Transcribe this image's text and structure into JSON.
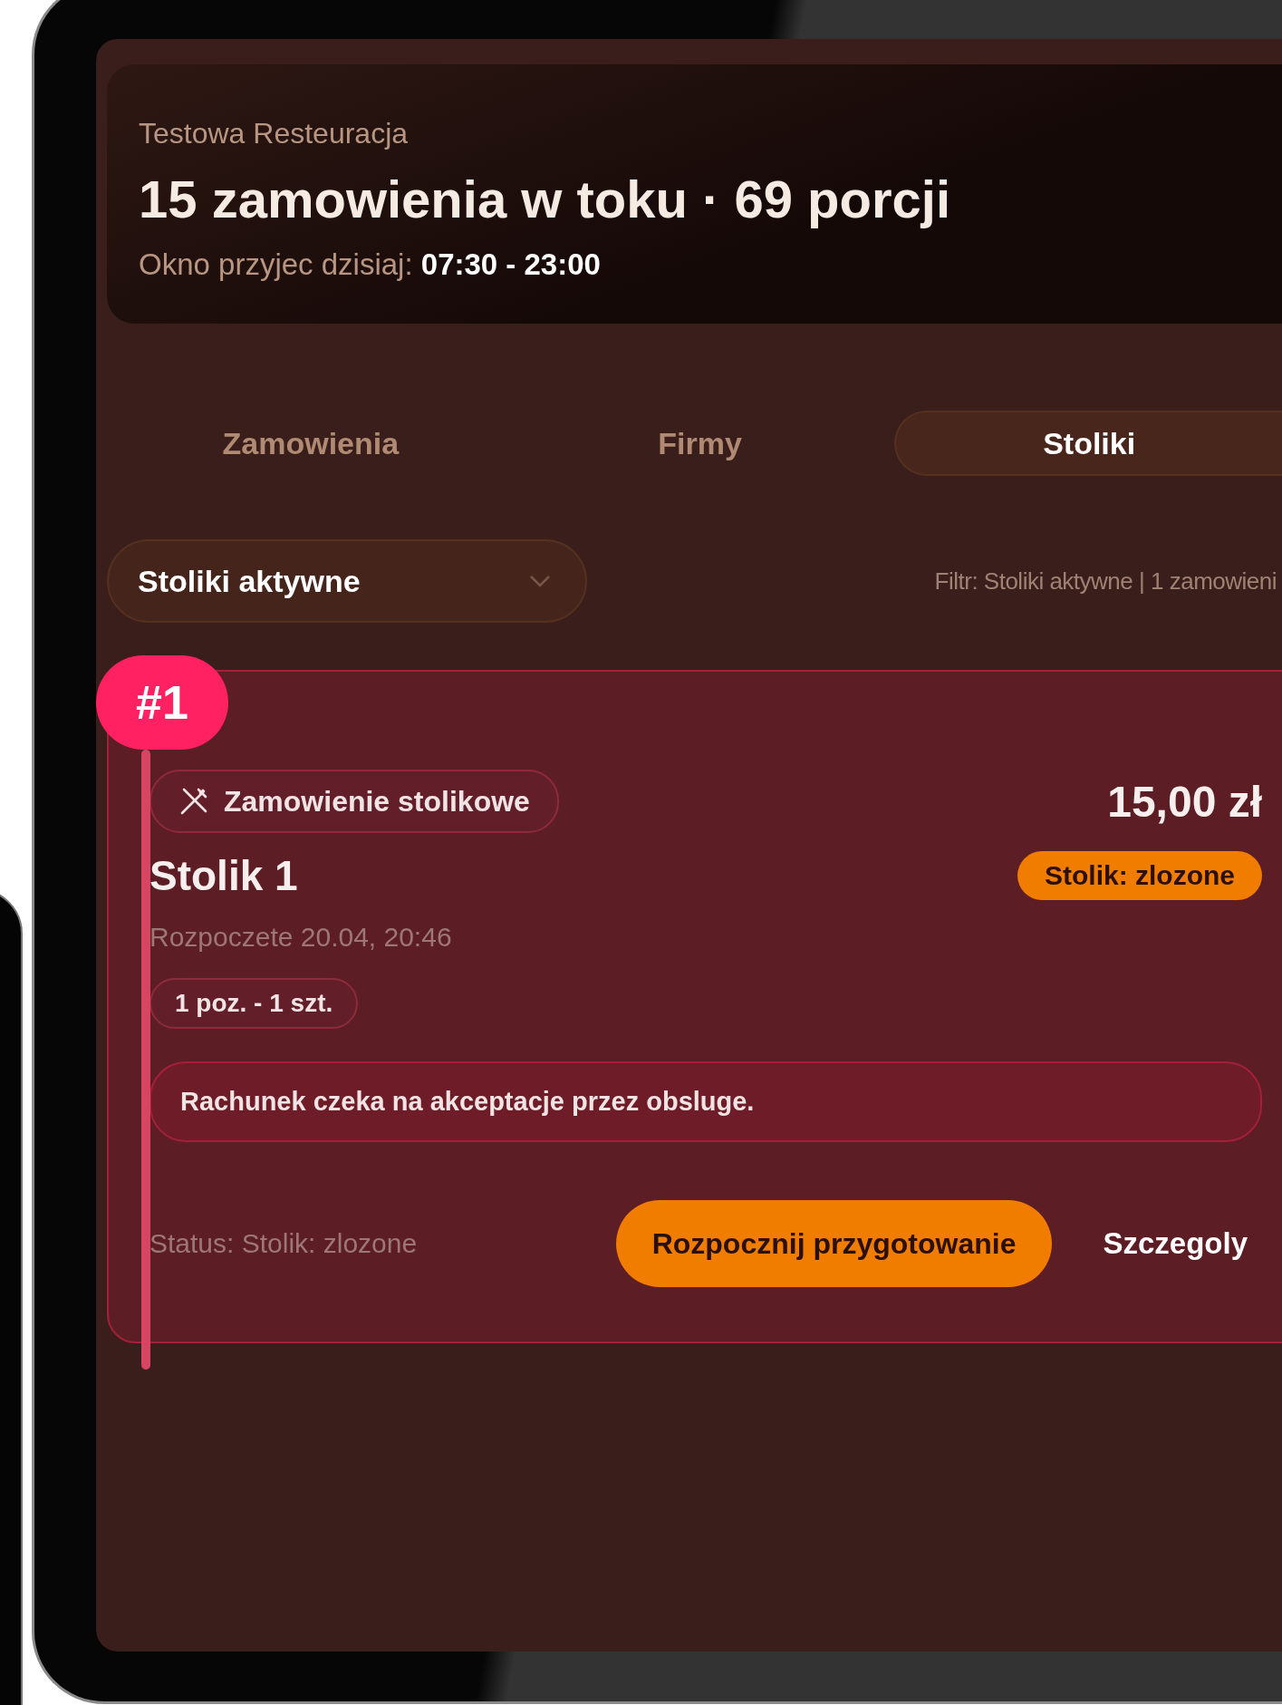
{
  "restaurant": "Testowa Resteuracja",
  "headline": "15 zamowienia w toku · 69 porcji",
  "hours": "Okno przyjec dzisiaj: **07:30 - 23:00**",
  "tabs": [
    {
      "label": "Zamowienia",
      "selected": false
    },
    {
      "label": "Firmy",
      "selected": false
    },
    {
      "label": "Stoliki",
      "selected": true
    }
  ],
  "filter_dropdown": {
    "value": "Stoliki aktywne"
  },
  "filter_summary": "Filtr: Stoliki aktywne | 1 zamowieni",
  "orders": [
    {
      "number": "#1",
      "type_label": "Zamowienie stolikowe",
      "price": "15,00 zł",
      "title": "Stolik 1",
      "status_badge": "Stolik: zlozone",
      "started": "Rozpoczete 20.04, 20:46",
      "items": "1 poz. - 1 szt.",
      "message": "Rachunek czeka na akceptacje przez obsluge.",
      "status_text": "Status: Stolik: zlozone",
      "primary_action": "Rozpocznij przygotowanie",
      "secondary_action": "Szczegoly"
    }
  ]
}
